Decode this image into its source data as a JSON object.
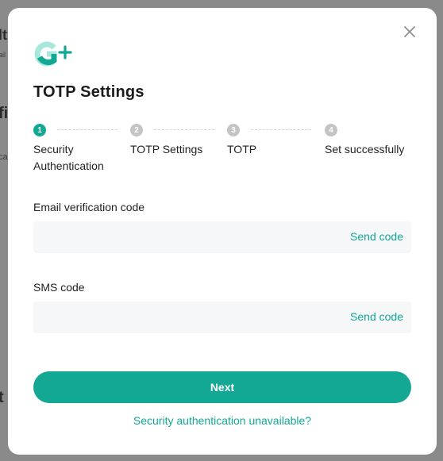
{
  "background": {
    "fragments": [
      "lt",
      "ail",
      "fi",
      "ca",
      "t"
    ]
  },
  "modal": {
    "title": "TOTP Settings",
    "close_icon": "close-icon",
    "logo_icon": "g-plus-logo-icon",
    "steps": [
      {
        "number": "1",
        "label": "Security Authentication",
        "state": "active"
      },
      {
        "number": "2",
        "label": "TOTP Settings",
        "state": "inactive"
      },
      {
        "number": "3",
        "label": "TOTP",
        "state": "inactive"
      },
      {
        "number": "4",
        "label": "Set successfully",
        "state": "inactive"
      }
    ],
    "email_field": {
      "label": "Email verification code",
      "value": "",
      "placeholder": "",
      "action_label": "Send code"
    },
    "sms_field": {
      "label": "SMS code",
      "value": "",
      "placeholder": "",
      "action_label": "Send code"
    },
    "next_label": "Next",
    "unavailable_link": "Security authentication unavailable?"
  },
  "colors": {
    "accent": "#12a893",
    "overlay": "#8a8a8a",
    "inactive_step": "#c4c4c4",
    "input_bg": "#f6f7f9"
  }
}
